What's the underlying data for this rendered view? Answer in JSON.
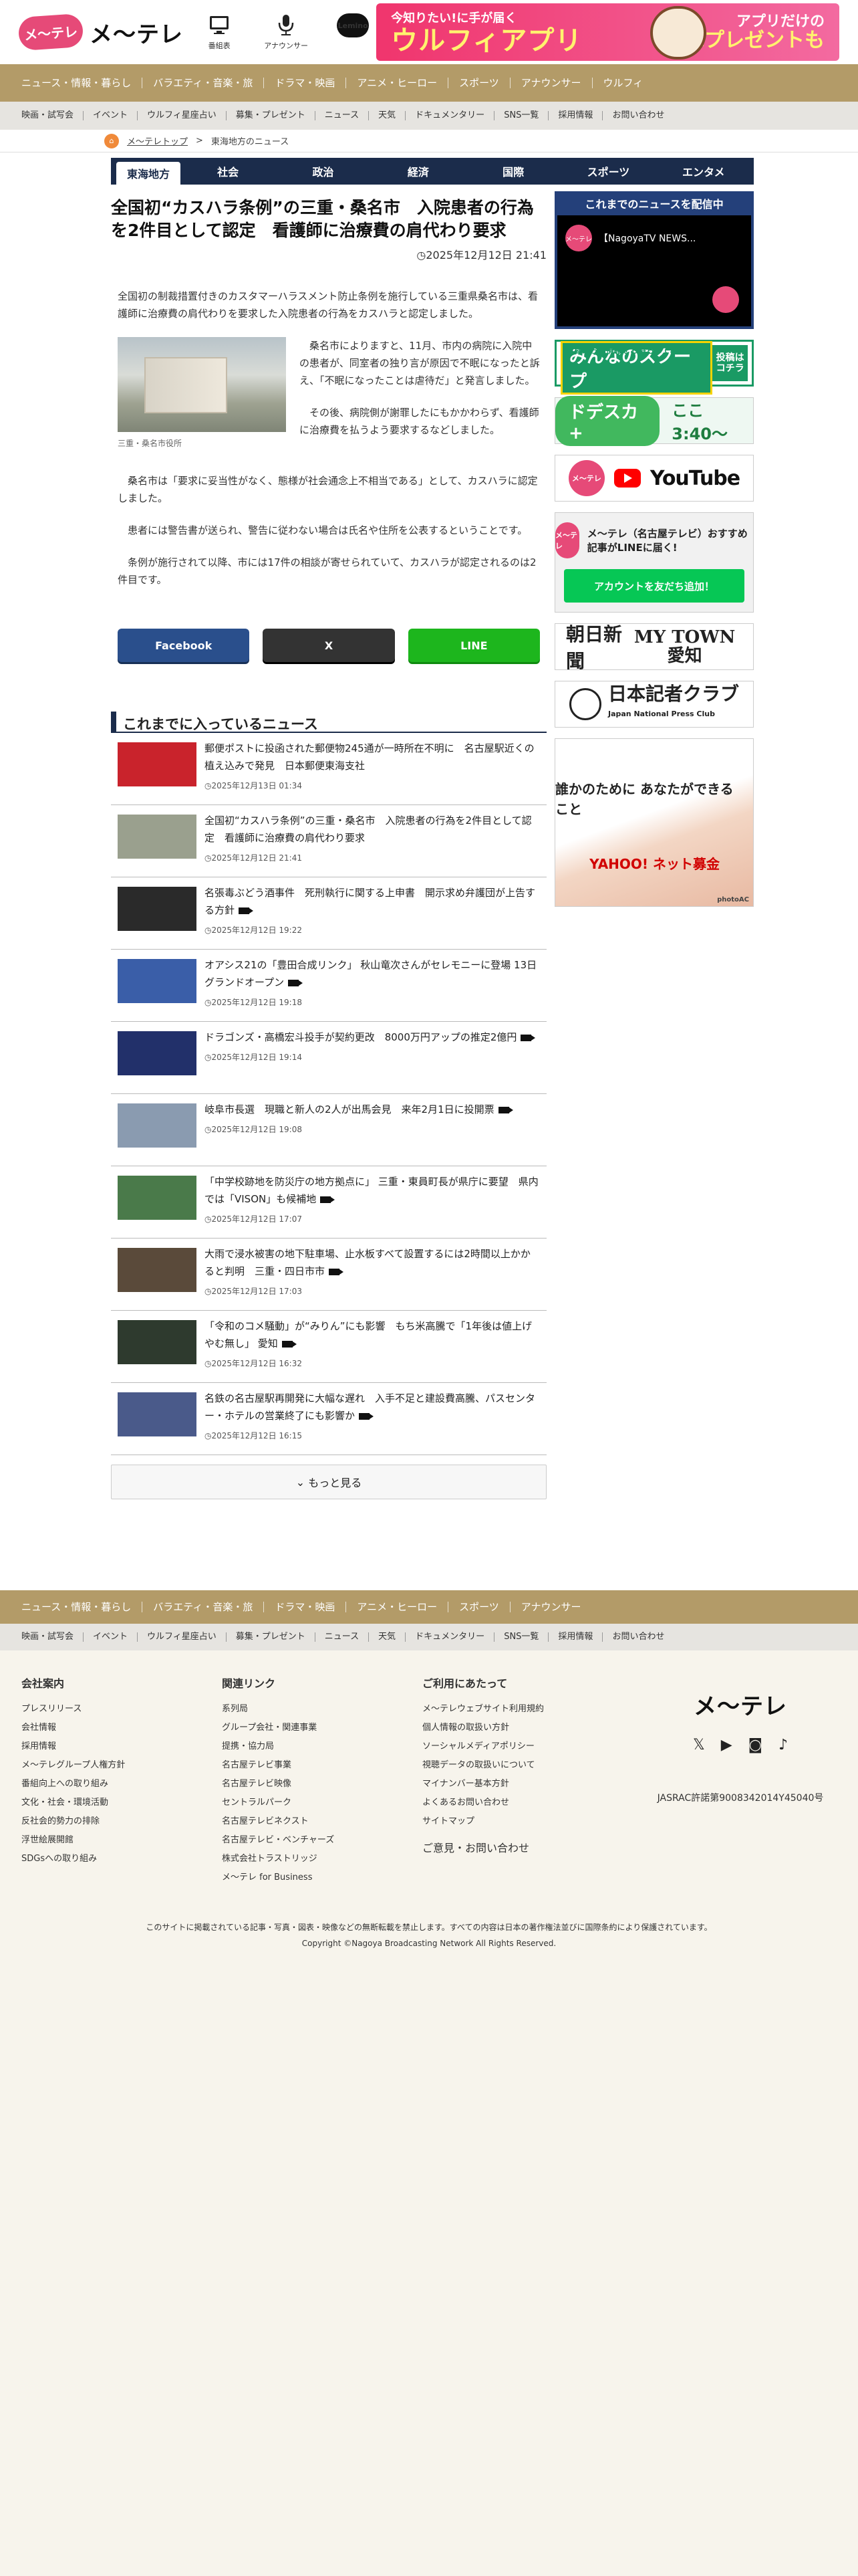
{
  "header": {
    "logo_mark": "メ〜テレ",
    "logo_word": "メ〜テレ",
    "icons": [
      {
        "label": "番組表",
        "icon": "tv-icon"
      },
      {
        "label": "アナウンサー",
        "icon": "microphone-icon"
      },
      {
        "label": "Lemino",
        "icon": "lemino-icon"
      }
    ],
    "banner": {
      "line1": "今知りたい!に手が届く",
      "line2": "ウルフィアプリ",
      "line3": "アプリだけの",
      "line4": "豪華プレゼントも"
    }
  },
  "nav_main": [
    "ニュース・情報・暮らし",
    "バラエティ・音楽・旅",
    "ドラマ・映画",
    "アニメ・ヒーロー",
    "スポーツ",
    "アナウンサー",
    "ウルフィ"
  ],
  "nav_sub": [
    "映画・試写会",
    "イベント",
    "ウルフィ星座占い",
    "募集・プレゼント",
    "ニュース",
    "天気",
    "ドキュメンタリー",
    "SNS一覧",
    "採用情報",
    "お問い合わせ"
  ],
  "breadcrumb": {
    "home": "メ〜テレトップ",
    "sep": ">",
    "current": "東海地方のニュース"
  },
  "categories": [
    "東海地方",
    "社会",
    "政治",
    "経済",
    "国際",
    "スポーツ",
    "エンタメ"
  ],
  "article": {
    "title": "全国初“カスハラ条例”の三重・桑名市　入院患者の行為を2件目として認定　看護師に治療費の肩代わり要求",
    "date": "2025年12月12日 21:41",
    "lead": "全国初の制裁措置付きのカスタマーハラスメント防止条例を施行している三重県桑名市は、看護師に治療費の肩代わりを要求した入院患者の行為をカスハラと認定しました。",
    "photo_caption": "三重・桑名市役所",
    "p1": "桑名市によりますと、11月、市内の病院に入院中の患者が、同室者の独り言が原因で不眠になったと訴え、「不眠になったことは虐待だ」と発言しました。",
    "p2": "その後、病院側が謝罪したにもかかわらず、看護師に治療費を払うよう要求するなどしました。",
    "p3": "桑名市は「要求に妥当性がなく、態様が社会通念上不相当である」として、カスハラに認定しました。",
    "p4": "患者には警告書が送られ、警告に従わない場合は氏名や住所を公表するということです。",
    "p5": "条例が施行されて以降、市には17件の相談が寄せられていて、カスハラが認定されるのは2件目です。"
  },
  "share": {
    "facebook": "Facebook",
    "x": "X",
    "line": "LINE"
  },
  "list": {
    "heading": "これまでに入っているニュース",
    "items": [
      {
        "title": "郵便ポストに投函された郵便物245通が一時所在不明に　名古屋駅近くの植え込みで発見　日本郵便東海支社",
        "time": "2025年12月13日 01:34",
        "video": false,
        "thumb": "#c9232c"
      },
      {
        "title": "全国初“カスハラ条例”の三重・桑名市　入院患者の行為を2件目として認定　看護師に治療費の肩代わり要求",
        "time": "2025年12月12日 21:41",
        "video": false,
        "thumb": "#9aa08e"
      },
      {
        "title": "名張毒ぶどう酒事件　死刑執行に関する上申書　開示求め弁護団が上告する方針",
        "time": "2025年12月12日 19:22",
        "video": true,
        "thumb": "#2a2a2a"
      },
      {
        "title": "オアシス21の「豊田合成リンク」 秋山竜次さんがセレモニーに登場 13日グランドオープン",
        "time": "2025年12月12日 19:18",
        "video": true,
        "thumb": "#3a5ea8"
      },
      {
        "title": "ドラゴンズ・高橋宏斗投手が契約更改　8000万円アップの推定2億円",
        "time": "2025年12月12日 19:14",
        "video": true,
        "thumb": "#22306a"
      },
      {
        "title": "岐阜市長選　現職と新人の2人が出馬会見　来年2月1日に投開票",
        "time": "2025年12月12日 19:08",
        "video": true,
        "thumb": "#8a9bb0"
      },
      {
        "title": "「中学校跡地を防災庁の地方拠点に」 三重・東員町長が県庁に要望　県内では「VISON」も候補地",
        "time": "2025年12月12日 17:07",
        "video": true,
        "thumb": "#4a7a4a"
      },
      {
        "title": "大雨で浸水被害の地下駐車場、止水板すべて設置するには2時間以上かかると判明　三重・四日市市",
        "time": "2025年12月12日 17:03",
        "video": true,
        "thumb": "#5a4a3a"
      },
      {
        "title": "「令和のコメ騒動」が“みりん”にも影響　もち米高騰で「1年後は値上げやむ無し」 愛知",
        "time": "2025年12月12日 16:32",
        "video": true,
        "thumb": "#2e3a2e"
      },
      {
        "title": "名鉄の名古屋駅再開発に大幅な遅れ　入手不足と建設費高騰、パスセンター・ホテルの営業終了にも影響か",
        "time": "2025年12月12日 16:15",
        "video": true,
        "thumb": "#4a5a8a"
      }
    ],
    "more": "もっと見る"
  },
  "side": {
    "video_head": "これまでのニュースを配信中",
    "video_title": "【NagoyaTV NEWS...",
    "scoop_a": "皆様からの情報をお待ちしております",
    "scoop_b": "みんなのスクープ",
    "scoop_c": "投稿はコチラ",
    "dorasuka": "ドデスカ+",
    "dorasuka_time": "ここ3:40〜",
    "youtube": "YouTube",
    "line_text": "メ〜テレ（名古屋テレビ）おすすめ記事がLINEに届く!",
    "line_btn": "アカウントを友だち追加！",
    "asahi": "朝日新聞",
    "mytown": "MY TOWN 愛知",
    "press": "日本記者クラブ",
    "press_en": "Japan National Press Club",
    "yh_text": "誰かのために あなたができること",
    "yh_brand": "YAHOO! ネット募金",
    "photo": "photoAC"
  },
  "footer": {
    "nav_main": [
      "ニュース・情報・暮らし",
      "バラエティ・音楽・旅",
      "ドラマ・映画",
      "アニメ・ヒーロー",
      "スポーツ",
      "アナウンサー"
    ],
    "nav_sub": [
      "映画・試写会",
      "イベント",
      "ウルフィ星座占い",
      "募集・プレゼント",
      "ニュース",
      "天気",
      "ドキュメンタリー",
      "SNS一覧",
      "採用情報",
      "お問い合わせ"
    ],
    "col1_title": "会社案内",
    "col1": [
      "プレスリリース",
      "会社情報",
      "採用情報",
      "メ〜テレグループ人権方針",
      "番組向上への取り組み",
      "文化・社会・環境活動",
      "反社会的勢力の排除",
      "浮世絵展開館",
      "SDGsへの取り組み"
    ],
    "col2_title": "関連リンク",
    "col2": [
      "系列局",
      "グループ会社・関連事業",
      "提携・協力局",
      "名古屋テレビ事業",
      "名古屋テレビ映像",
      "セントラルパーク",
      "名古屋テレビネクスト",
      "名古屋テレビ・ベンチャーズ",
      "株式会社トラストリッジ",
      "メ〜テレ for Business"
    ],
    "col3_title": "ご利用にあたって",
    "col3": [
      "メ〜テレウェブサイト利用規約",
      "個人情報の取扱い方針",
      "ソーシャルメディアポリシー",
      "視聴データの取扱いについて",
      "マイナンバー基本方針",
      "よくあるお問い合わせ",
      "サイトマップ"
    ],
    "opinion": "ご意見・お問い合わせ",
    "brand": "メ〜テレ",
    "jasrac": "JASRAC許諾第9008342014Y45040号",
    "notice": "このサイトに掲載されている記事・写真・図表・映像などの無断転載を禁止します。すべての内容は日本の著作権法並びに国際条約により保護されています。",
    "copyright": "Copyright ©Nagoya Broadcasting Network All Rights Reserved."
  }
}
